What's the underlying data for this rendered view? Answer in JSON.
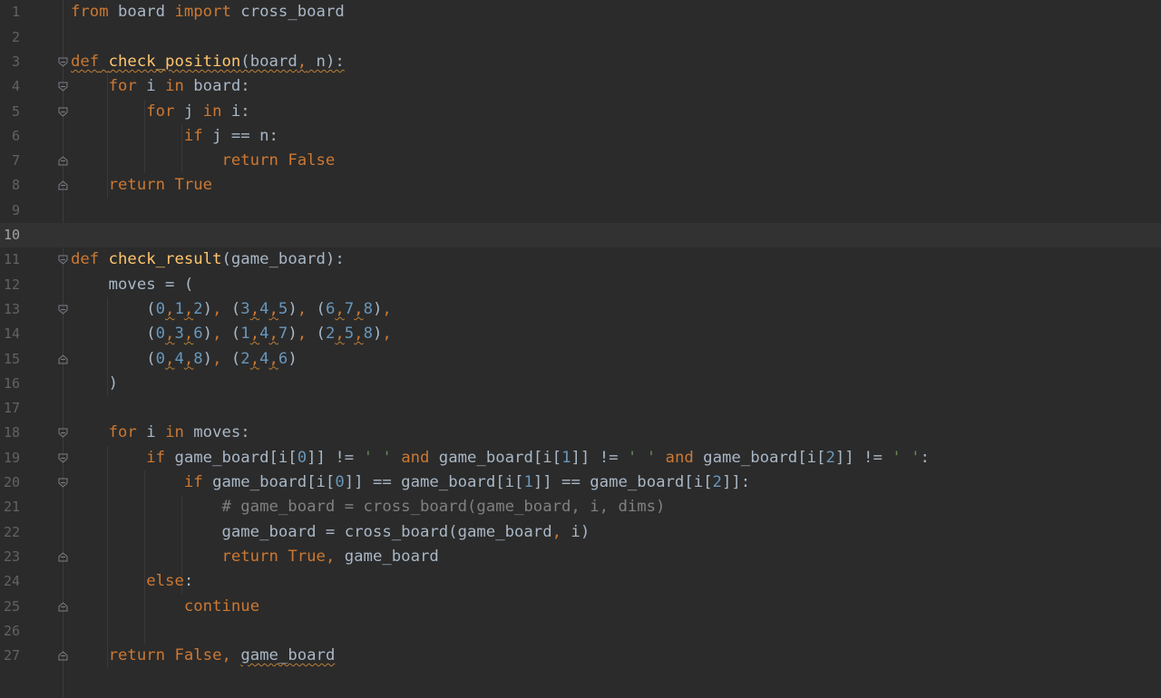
{
  "editor": {
    "lines": [
      {
        "n": "1",
        "tokens": [
          {
            "t": "from",
            "c": "kw"
          },
          {
            "t": " board "
          },
          {
            "t": "import",
            "c": "kw"
          },
          {
            "t": " cross_board"
          }
        ]
      },
      {
        "n": "2",
        "tokens": []
      },
      {
        "n": "3",
        "fold": "open",
        "tokens": [
          {
            "t": "def",
            "c": "kw weak"
          },
          {
            "t": " ",
            "c": "weak"
          },
          {
            "t": "check_position",
            "c": "fn weak"
          },
          {
            "t": "(board",
            "c": "weak"
          },
          {
            "t": ",",
            "c": "kw weak"
          },
          {
            "t": " n):",
            "c": "weak"
          }
        ]
      },
      {
        "n": "4",
        "fold": "open",
        "tokens": [
          {
            "t": "    "
          },
          {
            "t": "for",
            "c": "kw"
          },
          {
            "t": " i "
          },
          {
            "t": "in",
            "c": "kw"
          },
          {
            "t": " board:"
          }
        ]
      },
      {
        "n": "5",
        "fold": "open",
        "tokens": [
          {
            "t": "        "
          },
          {
            "t": "for",
            "c": "kw"
          },
          {
            "t": " j "
          },
          {
            "t": "in",
            "c": "kw"
          },
          {
            "t": " i:"
          }
        ]
      },
      {
        "n": "6",
        "tokens": [
          {
            "t": "            "
          },
          {
            "t": "if",
            "c": "kw"
          },
          {
            "t": " j == n:"
          }
        ]
      },
      {
        "n": "7",
        "fold": "close",
        "tokens": [
          {
            "t": "                "
          },
          {
            "t": "return",
            "c": "kw"
          },
          {
            "t": " "
          },
          {
            "t": "False",
            "c": "kw"
          }
        ]
      },
      {
        "n": "8",
        "fold": "close",
        "tokens": [
          {
            "t": "    "
          },
          {
            "t": "return",
            "c": "kw"
          },
          {
            "t": " "
          },
          {
            "t": "True",
            "c": "kw"
          }
        ]
      },
      {
        "n": "9",
        "tokens": []
      },
      {
        "n": "10",
        "current": true,
        "tokens": []
      },
      {
        "n": "11",
        "fold": "open",
        "tokens": [
          {
            "t": "def",
            "c": "kw"
          },
          {
            "t": " "
          },
          {
            "t": "check_result",
            "c": "fn"
          },
          {
            "t": "(game_board):"
          }
        ]
      },
      {
        "n": "12",
        "tokens": [
          {
            "t": "    moves = ("
          }
        ]
      },
      {
        "n": "13",
        "fold": "open",
        "tokens": [
          {
            "t": "        ("
          },
          {
            "t": "0",
            "c": "num"
          },
          {
            "t": ",",
            "c": "kw weak"
          },
          {
            "t": "1",
            "c": "num"
          },
          {
            "t": ",",
            "c": "kw weak"
          },
          {
            "t": "2",
            "c": "num"
          },
          {
            "t": ")"
          },
          {
            "t": ",",
            "c": "kw"
          },
          {
            "t": " ("
          },
          {
            "t": "3",
            "c": "num"
          },
          {
            "t": ",",
            "c": "kw weak"
          },
          {
            "t": "4",
            "c": "num"
          },
          {
            "t": ",",
            "c": "kw weak"
          },
          {
            "t": "5",
            "c": "num"
          },
          {
            "t": ")"
          },
          {
            "t": ",",
            "c": "kw"
          },
          {
            "t": " ("
          },
          {
            "t": "6",
            "c": "num"
          },
          {
            "t": ",",
            "c": "kw weak"
          },
          {
            "t": "7",
            "c": "num"
          },
          {
            "t": ",",
            "c": "kw weak"
          },
          {
            "t": "8",
            "c": "num"
          },
          {
            "t": ")"
          },
          {
            "t": ",",
            "c": "kw"
          }
        ]
      },
      {
        "n": "14",
        "tokens": [
          {
            "t": "        ("
          },
          {
            "t": "0",
            "c": "num"
          },
          {
            "t": ",",
            "c": "kw weak"
          },
          {
            "t": "3",
            "c": "num"
          },
          {
            "t": ",",
            "c": "kw weak"
          },
          {
            "t": "6",
            "c": "num"
          },
          {
            "t": ")"
          },
          {
            "t": ",",
            "c": "kw"
          },
          {
            "t": " ("
          },
          {
            "t": "1",
            "c": "num"
          },
          {
            "t": ",",
            "c": "kw weak"
          },
          {
            "t": "4",
            "c": "num"
          },
          {
            "t": ",",
            "c": "kw weak"
          },
          {
            "t": "7",
            "c": "num"
          },
          {
            "t": ")"
          },
          {
            "t": ",",
            "c": "kw"
          },
          {
            "t": " ("
          },
          {
            "t": "2",
            "c": "num"
          },
          {
            "t": ",",
            "c": "kw weak"
          },
          {
            "t": "5",
            "c": "num"
          },
          {
            "t": ",",
            "c": "kw weak"
          },
          {
            "t": "8",
            "c": "num"
          },
          {
            "t": ")"
          },
          {
            "t": ",",
            "c": "kw"
          }
        ]
      },
      {
        "n": "15",
        "fold": "close",
        "tokens": [
          {
            "t": "        ("
          },
          {
            "t": "0",
            "c": "num"
          },
          {
            "t": ",",
            "c": "kw weak"
          },
          {
            "t": "4",
            "c": "num"
          },
          {
            "t": ",",
            "c": "kw weak"
          },
          {
            "t": "8",
            "c": "num"
          },
          {
            "t": ")"
          },
          {
            "t": ",",
            "c": "kw"
          },
          {
            "t": " ("
          },
          {
            "t": "2",
            "c": "num"
          },
          {
            "t": ",",
            "c": "kw weak"
          },
          {
            "t": "4",
            "c": "num"
          },
          {
            "t": ",",
            "c": "kw weak"
          },
          {
            "t": "6",
            "c": "num"
          },
          {
            "t": ")"
          }
        ]
      },
      {
        "n": "16",
        "tokens": [
          {
            "t": "    )"
          }
        ]
      },
      {
        "n": "17",
        "tokens": []
      },
      {
        "n": "18",
        "fold": "open",
        "tokens": [
          {
            "t": "    "
          },
          {
            "t": "for",
            "c": "kw"
          },
          {
            "t": " i "
          },
          {
            "t": "in",
            "c": "kw"
          },
          {
            "t": " moves:"
          }
        ]
      },
      {
        "n": "19",
        "fold": "open",
        "tokens": [
          {
            "t": "        "
          },
          {
            "t": "if",
            "c": "kw"
          },
          {
            "t": " game_board[i["
          },
          {
            "t": "0",
            "c": "num"
          },
          {
            "t": "]] != "
          },
          {
            "t": "' '",
            "c": "str"
          },
          {
            "t": " "
          },
          {
            "t": "and",
            "c": "kw"
          },
          {
            "t": " game_board[i["
          },
          {
            "t": "1",
            "c": "num"
          },
          {
            "t": "]] != "
          },
          {
            "t": "' '",
            "c": "str"
          },
          {
            "t": " "
          },
          {
            "t": "and",
            "c": "kw"
          },
          {
            "t": " game_board[i["
          },
          {
            "t": "2",
            "c": "num"
          },
          {
            "t": "]] != "
          },
          {
            "t": "' '",
            "c": "str"
          },
          {
            "t": ":"
          }
        ]
      },
      {
        "n": "20",
        "fold": "open",
        "tokens": [
          {
            "t": "            "
          },
          {
            "t": "if",
            "c": "kw"
          },
          {
            "t": " game_board[i["
          },
          {
            "t": "0",
            "c": "num"
          },
          {
            "t": "]] == game_board[i["
          },
          {
            "t": "1",
            "c": "num"
          },
          {
            "t": "]] == game_board[i["
          },
          {
            "t": "2",
            "c": "num"
          },
          {
            "t": "]]:"
          }
        ]
      },
      {
        "n": "21",
        "tokens": [
          {
            "t": "                "
          },
          {
            "t": "# game_board = cross_board(game_board, i, dims)",
            "c": "cmt"
          }
        ]
      },
      {
        "n": "22",
        "tokens": [
          {
            "t": "                game_board = cross_board(game_board"
          },
          {
            "t": ",",
            "c": "kw"
          },
          {
            "t": " i)"
          }
        ]
      },
      {
        "n": "23",
        "fold": "close",
        "tokens": [
          {
            "t": "                "
          },
          {
            "t": "return",
            "c": "kw"
          },
          {
            "t": " "
          },
          {
            "t": "True",
            "c": "kw"
          },
          {
            "t": ",",
            "c": "kw"
          },
          {
            "t": " game_board"
          }
        ]
      },
      {
        "n": "24",
        "tokens": [
          {
            "t": "        "
          },
          {
            "t": "else",
            "c": "kw"
          },
          {
            "t": ":"
          }
        ]
      },
      {
        "n": "25",
        "fold": "close",
        "tokens": [
          {
            "t": "            "
          },
          {
            "t": "continue",
            "c": "kw"
          }
        ]
      },
      {
        "n": "26",
        "tokens": []
      },
      {
        "n": "27",
        "fold": "close",
        "tokens": [
          {
            "t": "    "
          },
          {
            "t": "return",
            "c": "kw"
          },
          {
            "t": " "
          },
          {
            "t": "False",
            "c": "kw"
          },
          {
            "t": ",",
            "c": "kw"
          },
          {
            "t": " "
          },
          {
            "t": "game_board",
            "c": "weak"
          }
        ]
      }
    ]
  },
  "colors": {
    "background": "#2b2b2b",
    "current_line": "#323232",
    "keyword": "#cc7832",
    "function": "#ffc66d",
    "number": "#6897bb",
    "string": "#6a8759",
    "comment": "#808080",
    "text": "#a9b7c6",
    "line_number": "#606366"
  }
}
